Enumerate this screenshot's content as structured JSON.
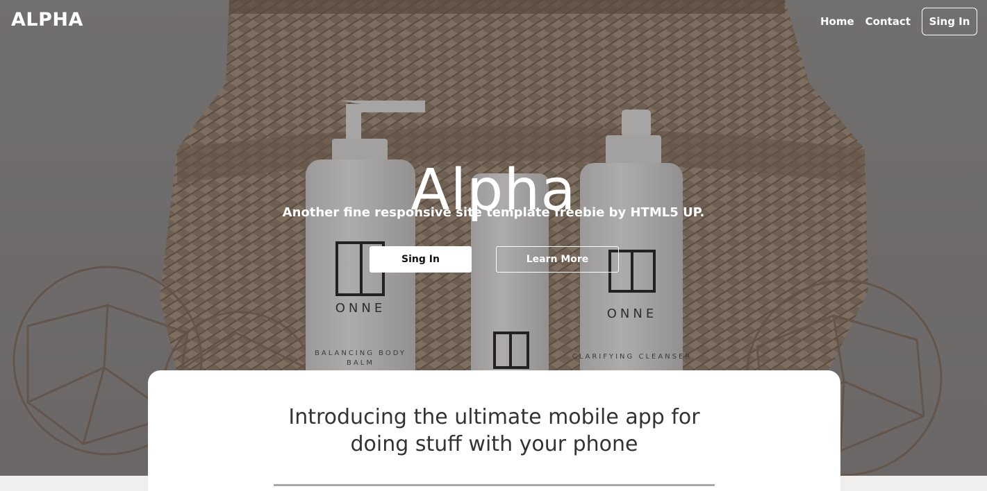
{
  "header": {
    "logo": "ALPHA",
    "nav": {
      "home": "Home",
      "contact": "Contact",
      "signin": "Sing In"
    }
  },
  "hero": {
    "title": "Alpha",
    "subtitle": "Another fine responsive site template freebie by HTML5 UP.",
    "primary_button": "Sing In",
    "secondary_button": "Learn More",
    "product_label": "ONNE",
    "product_left_caption": "BALANCING BODY BALM",
    "product_right_caption": "CLARIFYING CLEANSER"
  },
  "intro": {
    "line1": "Introducing the ultimate mobile app for",
    "line2": "doing stuff with your phone"
  },
  "colors": {
    "accent": "#ffffff",
    "text_dark": "#333333",
    "page_bg": "#f0efed"
  }
}
